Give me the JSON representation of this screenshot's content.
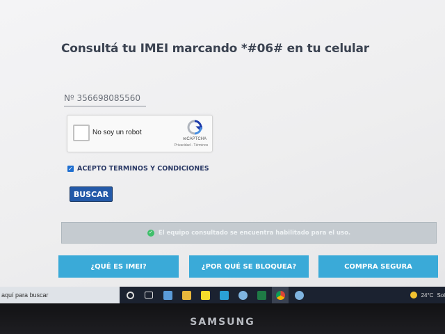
{
  "page": {
    "title": "Consultá tu IMEI marcando *#06# en tu celular",
    "imei_field": {
      "value": "Nº 356698085560"
    },
    "captcha": {
      "label": "No soy un robot",
      "brand": "reCAPTCHA",
      "links": "Privacidad - Términos"
    },
    "terms": {
      "checked": true,
      "label": "ACEPTO TERMINOS Y CONDICIONES"
    },
    "search_button": "BUSCAR",
    "status": {
      "icon": "check-circle-icon",
      "text": "El equipo consultado se encuentra habilitado para el uso."
    },
    "nav_buttons": [
      {
        "label": "¿QUÉ ES IMEI?"
      },
      {
        "label": "¿POR QUÉ SE BLOQUEA?"
      },
      {
        "label": "COMPRA SEGURA"
      }
    ]
  },
  "taskbar": {
    "search_placeholder": "aquí para buscar",
    "icons": [
      "cortana-icon",
      "task-view-icon",
      "calculator-icon",
      "file-explorer-icon",
      "sticky-notes-icon",
      "app-icon",
      "chat-icon",
      "excel-icon",
      "chrome-icon",
      "app2-icon"
    ],
    "weather": {
      "temp": "24°C",
      "condition": "Sol"
    }
  },
  "monitor": {
    "brand": "SAMSUNG"
  },
  "colors": {
    "nav_button": "#3aaad8",
    "search_button": "#2359a8",
    "status_bg": "#c5cbd0",
    "status_check": "#3fbf6b"
  }
}
